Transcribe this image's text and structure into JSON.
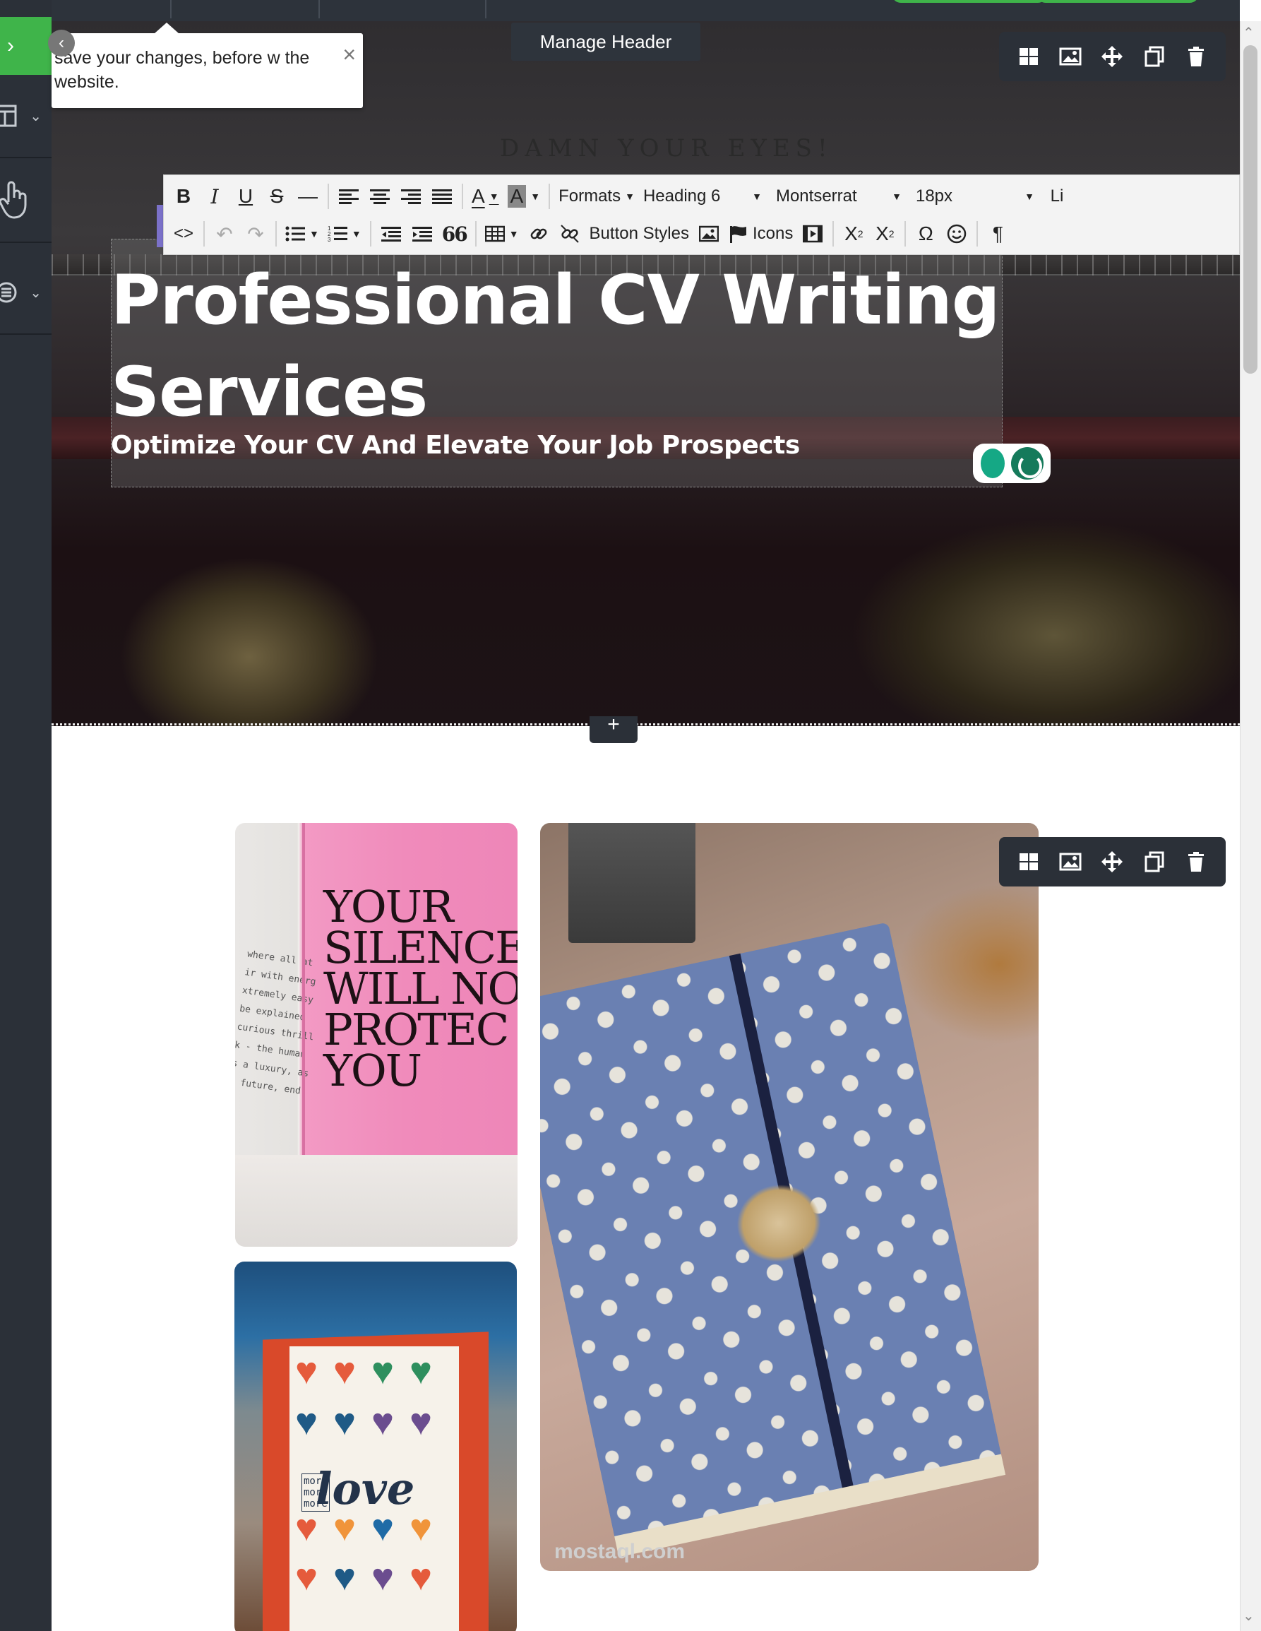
{
  "tooltip": {
    "text": "save your changes, before w the website.",
    "close_glyph": "×",
    "collapse_glyph": "‹"
  },
  "sidebar": {
    "toggle_glyph": "›",
    "items": [
      {
        "icon": "layout-icon"
      },
      {
        "icon": "hand-pointer-icon"
      },
      {
        "icon": "menu-lines-icon"
      }
    ]
  },
  "section_label": "Manage Header",
  "hero": {
    "backdrop_text": "DAMN YOUR EYES!",
    "title": "Professional CV Writing Services",
    "subtitle": "Optimize Your CV And Elevate Your Job Prospects"
  },
  "editor_toolbar": {
    "formats_label": "Formats",
    "heading_label": "Heading 6",
    "font_label": "Montserrat",
    "size_label": "18px",
    "line_label": "Li",
    "button_styles_label": "Button Styles",
    "icons_label": "Icons",
    "quote_glyph": "66"
  },
  "add_glyph": "+",
  "gallery": {
    "pink_book_text": "YOUR SILENCE WILL NO PROTEC YOU",
    "card_text": "love",
    "card_small_text": "more more more",
    "watermark": "mostaql.com"
  },
  "colors": {
    "sidebar": "#2b3038",
    "accent_green": "#3fb44a",
    "toolbar_bg": "#f3f3f3"
  }
}
